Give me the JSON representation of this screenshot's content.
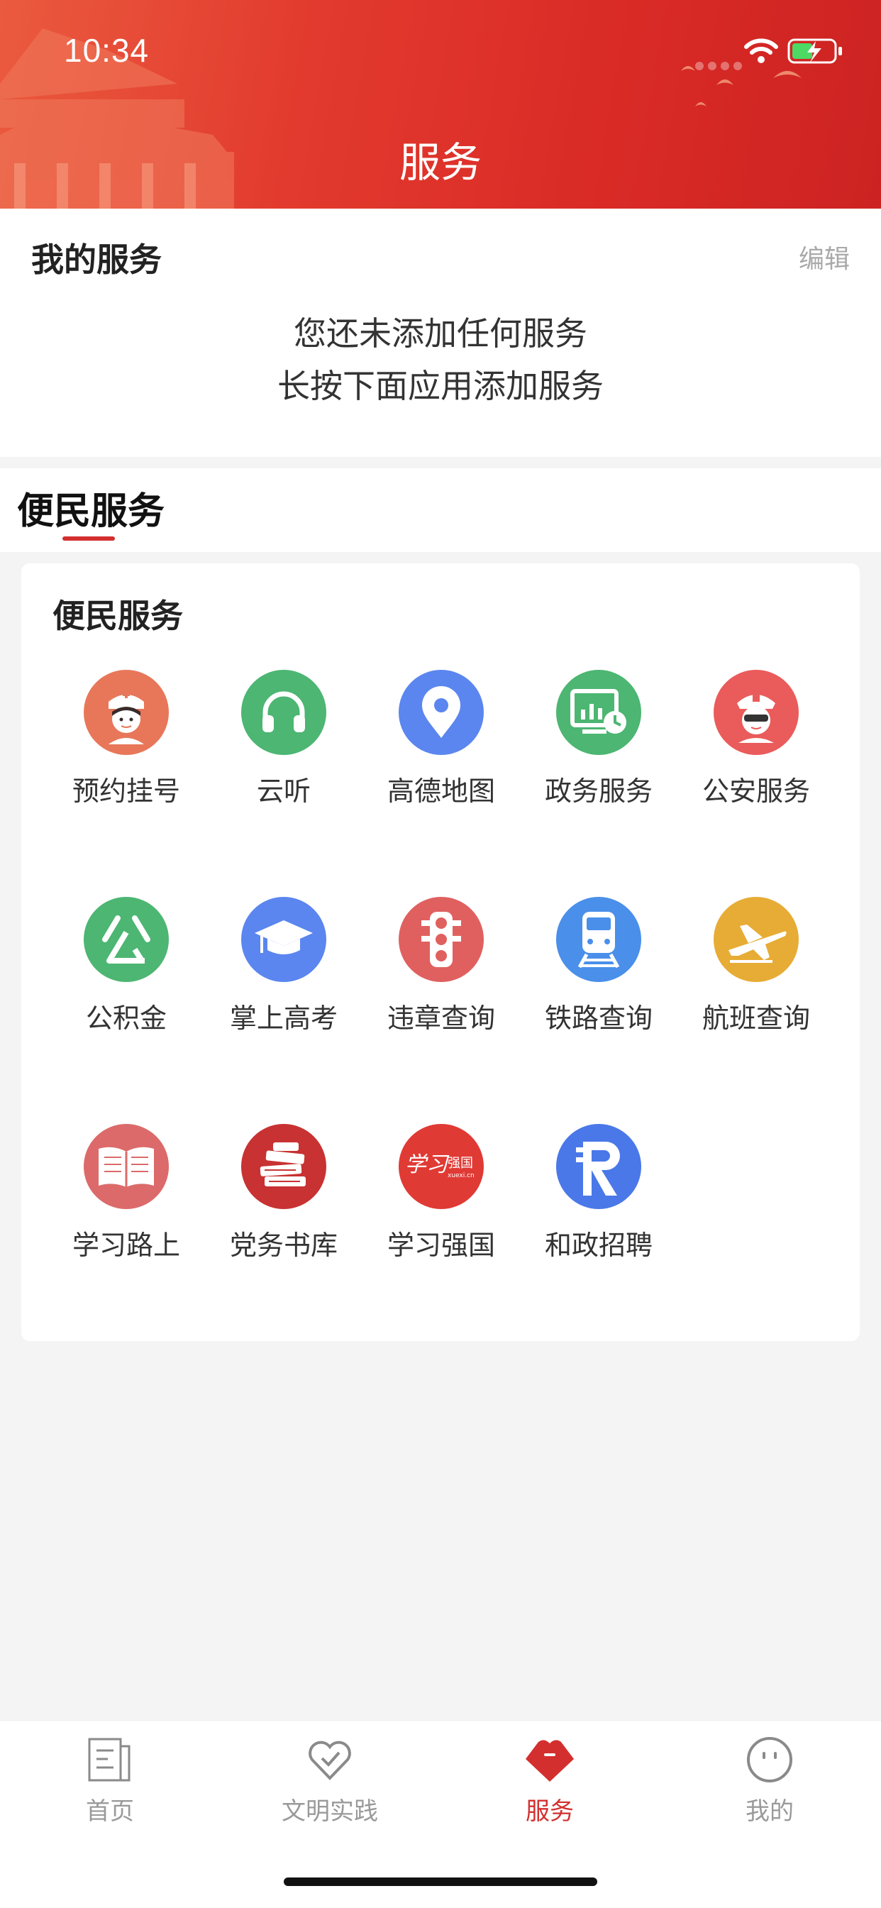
{
  "status_bar": {
    "time": "10:34"
  },
  "header": {
    "title": "服务"
  },
  "my_services": {
    "title": "我的服务",
    "edit_label": "编辑",
    "empty_line1": "您还未添加任何服务",
    "empty_line2": "长按下面应用添加服务"
  },
  "section_tab": {
    "label": "便民服务"
  },
  "service_card": {
    "title": "便民服务",
    "items": [
      {
        "label": "预约挂号",
        "icon": "nurse-icon",
        "color": "#e8775a"
      },
      {
        "label": "云听",
        "icon": "headphones-icon",
        "color": "#4cb672"
      },
      {
        "label": "高德地图",
        "icon": "map-pin-icon",
        "color": "#5b86ef"
      },
      {
        "label": "政务服务",
        "icon": "monitor-clock-icon",
        "color": "#4cb672"
      },
      {
        "label": "公安服务",
        "icon": "police-icon",
        "color": "#ea5b5b"
      },
      {
        "label": "公积金",
        "icon": "fund-icon",
        "color": "#4cb672"
      },
      {
        "label": "掌上高考",
        "icon": "graduation-cap-icon",
        "color": "#5b86ef"
      },
      {
        "label": "违章查询",
        "icon": "traffic-light-icon",
        "color": "#e06060"
      },
      {
        "label": "铁路查询",
        "icon": "train-icon",
        "color": "#4a8fea"
      },
      {
        "label": "航班查询",
        "icon": "airplane-icon",
        "color": "#e7ac35"
      },
      {
        "label": "学习路上",
        "icon": "open-book-icon",
        "color": "#dc6a6a"
      },
      {
        "label": "党务书库",
        "icon": "book-stack-icon",
        "color": "#c83232"
      },
      {
        "label": "学习强国",
        "icon": "xuexi-logo-icon",
        "color": "#e03a35"
      },
      {
        "label": "和政招聘",
        "icon": "r-logo-icon",
        "color": "#4a78e8"
      }
    ]
  },
  "bottom_nav": {
    "items": [
      {
        "label": "首页",
        "icon": "home-doc-icon",
        "active": false
      },
      {
        "label": "文明实践",
        "icon": "heart-check-icon",
        "active": false
      },
      {
        "label": "服务",
        "icon": "service-heart-icon",
        "active": true
      },
      {
        "label": "我的",
        "icon": "smiley-icon",
        "active": false
      }
    ],
    "active_color": "#d32f2f",
    "inactive_color": "#9a9a9a"
  }
}
